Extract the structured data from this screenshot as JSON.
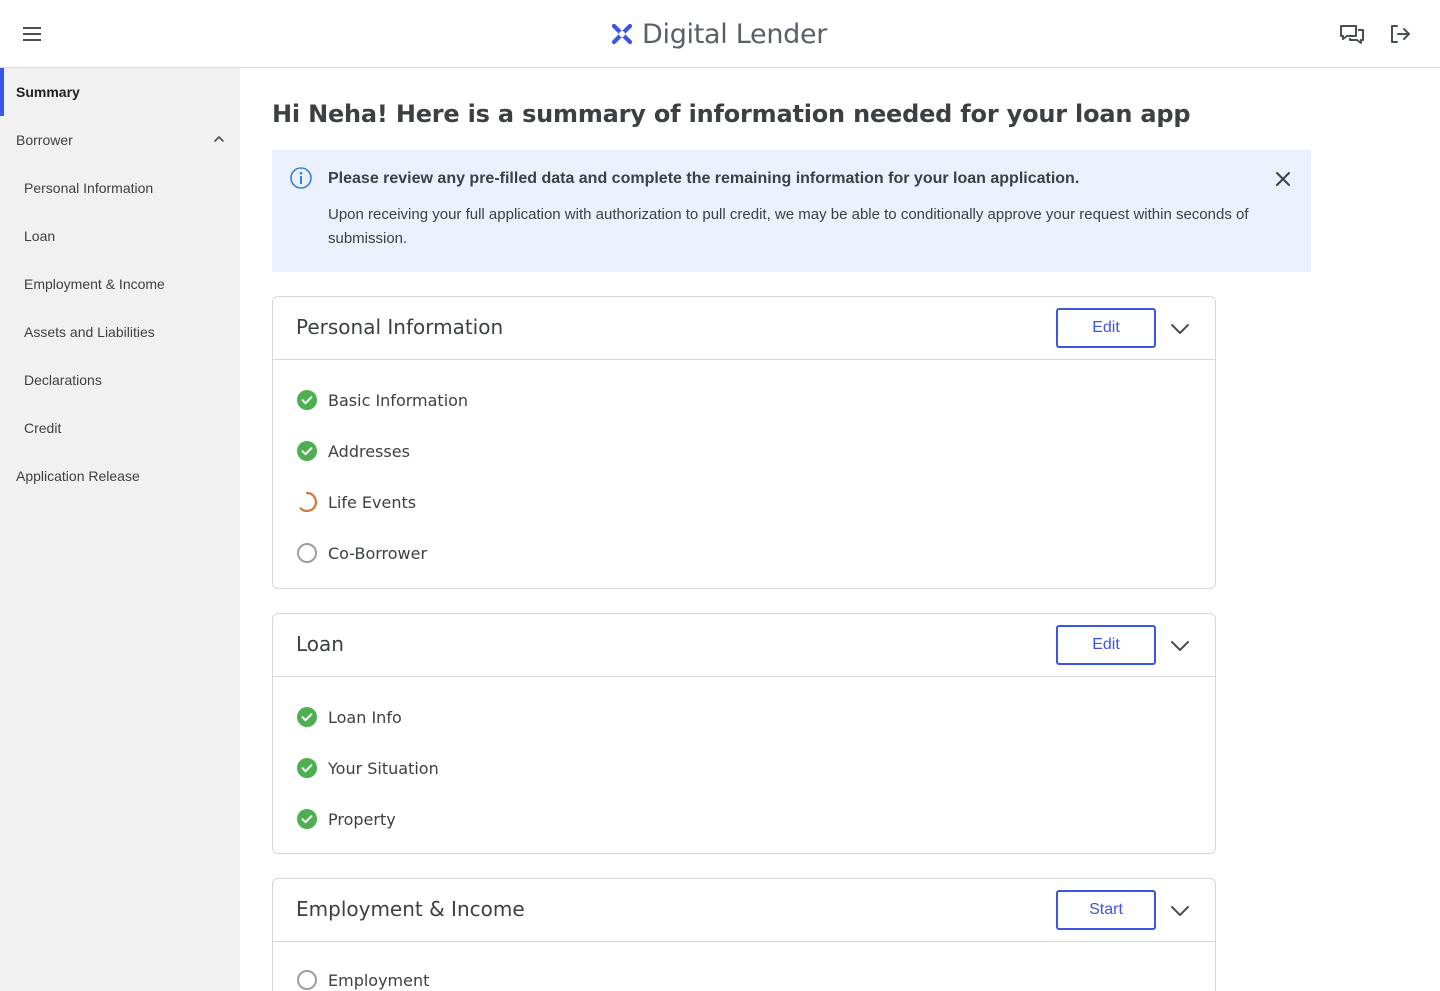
{
  "header": {
    "brand": "Digital Lender",
    "menu_icon": "hamburger-icon",
    "chat_icon": "chat-bubbles-icon",
    "logout_icon": "logout-icon"
  },
  "sidebar": {
    "items": [
      {
        "label": "Summary",
        "level": "top",
        "active": true
      },
      {
        "label": "Borrower",
        "level": "top",
        "expanded": true
      },
      {
        "label": "Personal Information",
        "level": "sub"
      },
      {
        "label": "Loan",
        "level": "sub"
      },
      {
        "label": "Employment & Income",
        "level": "sub"
      },
      {
        "label": "Assets and Liabilities",
        "level": "sub"
      },
      {
        "label": "Declarations",
        "level": "sub"
      },
      {
        "label": "Credit",
        "level": "sub"
      },
      {
        "label": "Application Release",
        "level": "top"
      }
    ]
  },
  "main": {
    "title": "Hi Neha! Here is a summary of information needed for your loan app",
    "banner": {
      "title": "Please review any pre-filled data and complete the remaining information for your loan application.",
      "body": "Upon receiving your full application with authorization to pull credit, we may be able to conditionally approve your request within seconds of submission."
    },
    "cards": [
      {
        "title": "Personal Information",
        "button": "Edit",
        "tasks": [
          {
            "label": "Basic Information",
            "status": "complete"
          },
          {
            "label": "Addresses",
            "status": "complete"
          },
          {
            "label": "Life Events",
            "status": "in-progress"
          },
          {
            "label": "Co-Borrower",
            "status": "not-started"
          }
        ]
      },
      {
        "title": "Loan",
        "button": "Edit",
        "tasks": [
          {
            "label": "Loan Info",
            "status": "complete"
          },
          {
            "label": "Your Situation",
            "status": "complete"
          },
          {
            "label": "Property",
            "status": "complete"
          }
        ]
      },
      {
        "title": "Employment & Income",
        "button": "Start",
        "tasks": [
          {
            "label": "Employment",
            "status": "not-started"
          }
        ]
      }
    ]
  },
  "colors": {
    "accent": "#3b55e6",
    "complete": "#4caf50",
    "in_progress": "#d2763a",
    "not_started": "#9e9e9e",
    "banner_bg": "#eaf1fd"
  }
}
